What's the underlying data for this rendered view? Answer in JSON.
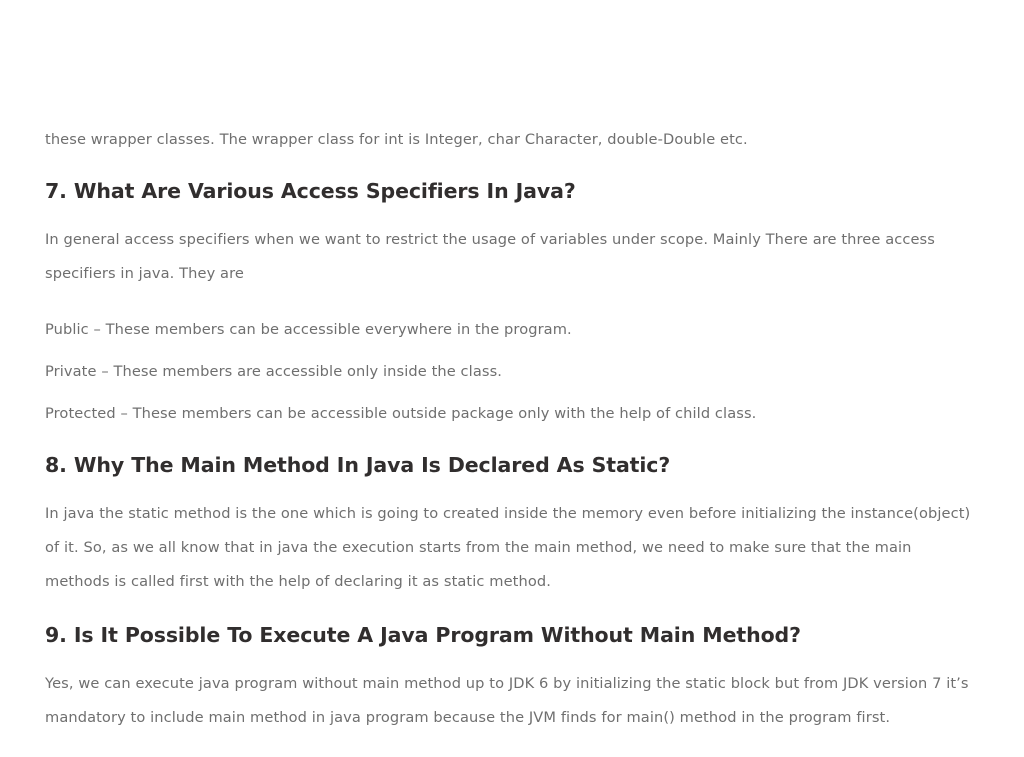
{
  "document": {
    "background_color": "#ffffff",
    "body_text_color": "#6f6f6f",
    "heading_text_color": "#312e2e"
  },
  "article": {
    "intro_continuation": "these wrapper classes. The wrapper class for int is Integer, char Character, double-Double etc.",
    "sections": [
      {
        "number": "7",
        "heading": "7. What Are Various Access Specifiers In Java?",
        "paragraphs": [
          "In general access specifiers when we want to restrict the usage of variables under scope. Mainly There are three access specifiers in java. They are"
        ],
        "specifiers": [
          "Public – These members can be accessible everywhere in the program.",
          "Private – These members are accessible only inside the class.",
          "Protected – These members can be accessible outside package only with the help of child class."
        ]
      },
      {
        "number": "8",
        "heading": "8. Why The Main Method In Java Is Declared As Static?",
        "paragraphs": [
          "In java the static method is the one which is going to created inside the memory even before initializing the instance(object) of it. So, as we all know that in java the execution starts from the main method, we need to make sure that the main methods is called first with the help of declaring it as static method."
        ],
        "specifiers": []
      },
      {
        "number": "9",
        "heading": "9. Is It Possible To Execute A Java Program Without Main Method?",
        "paragraphs": [
          "Yes, we can execute java program without main method up to JDK 6 by initializing the static block but from JDK version 7 it’s mandatory to include main method in java program because the JVM finds for main() method in the program first."
        ],
        "specifiers": []
      }
    ]
  }
}
